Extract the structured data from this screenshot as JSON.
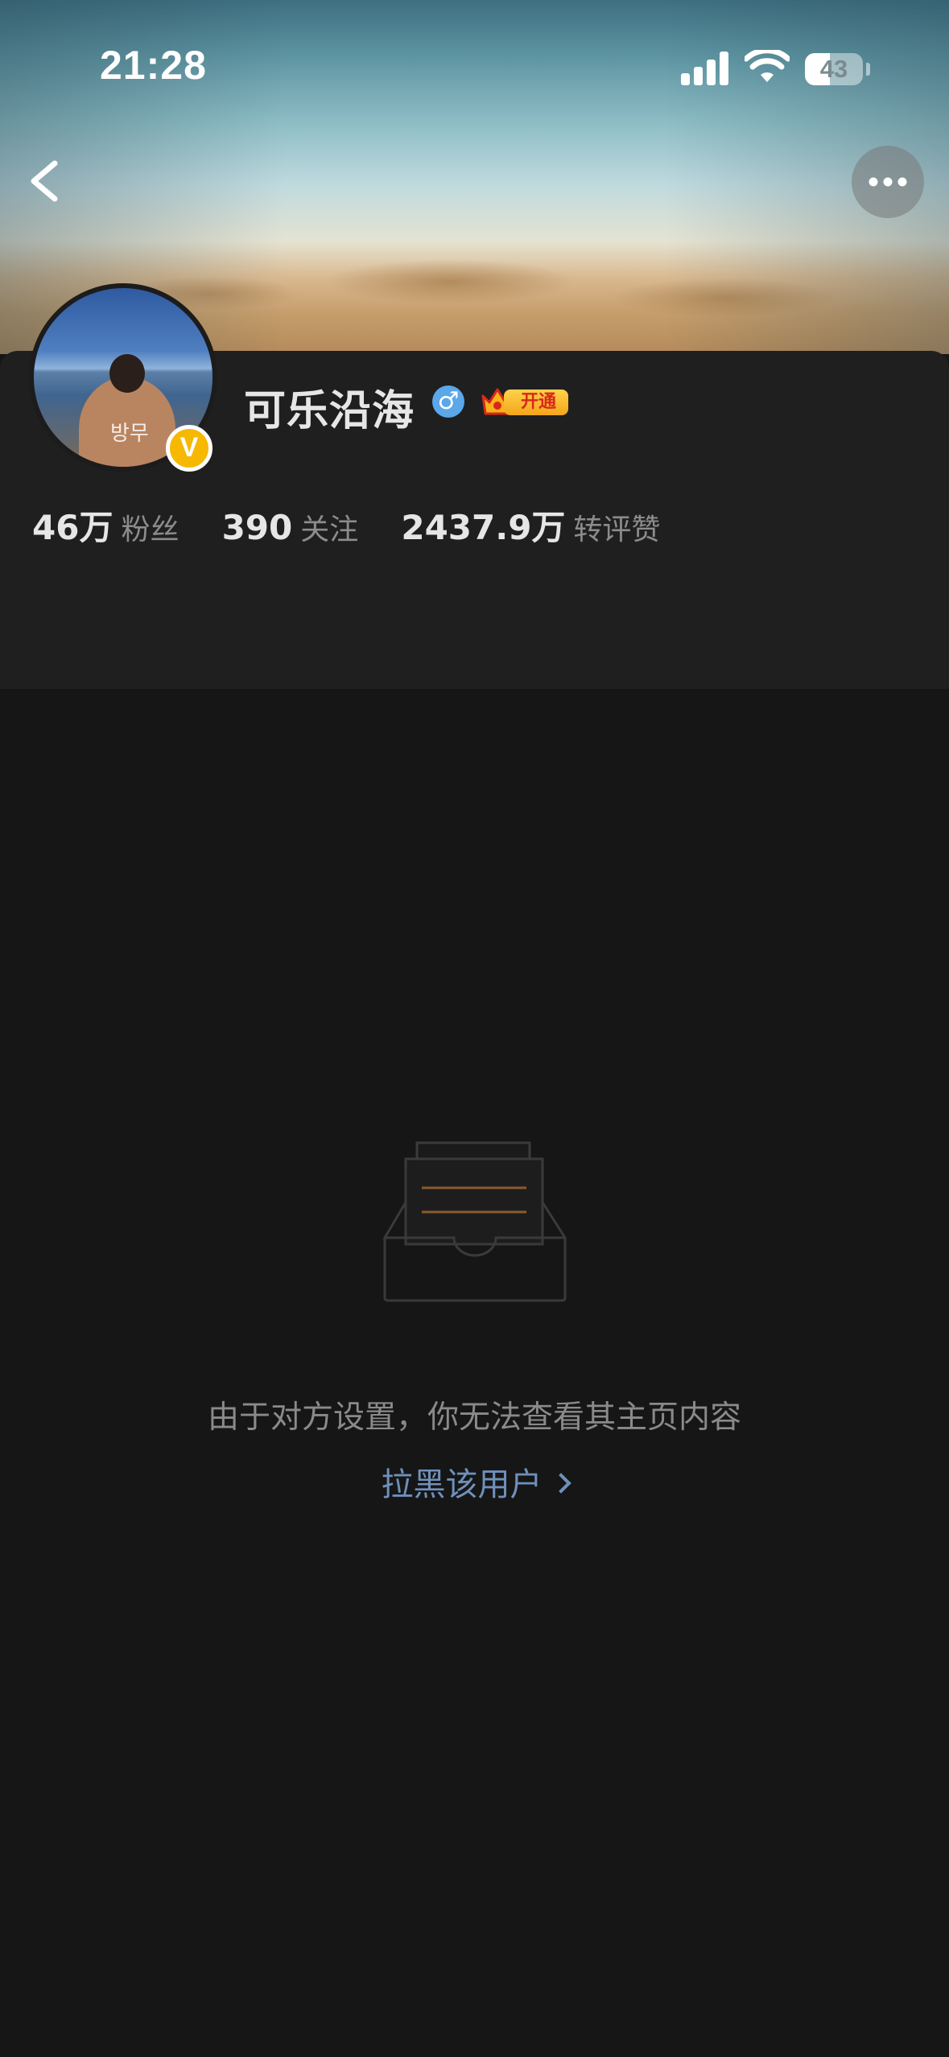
{
  "status_bar": {
    "time": "21:28",
    "battery_level": 43,
    "battery_text": "43"
  },
  "header": {
    "back_icon": "chevron-left-icon",
    "more_icon": "ellipsis-icon"
  },
  "profile": {
    "username": "可乐沿海",
    "gender_icon": "male-icon",
    "gender_symbol": "♂",
    "verified_symbol": "V",
    "vip_label": "开通",
    "verified_color": "#f6b800",
    "avatar_scribble": "방무",
    "stats": [
      {
        "value": "46万",
        "label": "粉丝"
      },
      {
        "value": "390",
        "label": "关注"
      },
      {
        "value": "2437.9万",
        "label": "转评赞"
      }
    ]
  },
  "empty_state": {
    "icon": "empty-inbox-icon",
    "message": "由于对方设置，你无法查看其主页内容",
    "block_link": "拉黑该用户",
    "link_color": "#6f90bb"
  }
}
